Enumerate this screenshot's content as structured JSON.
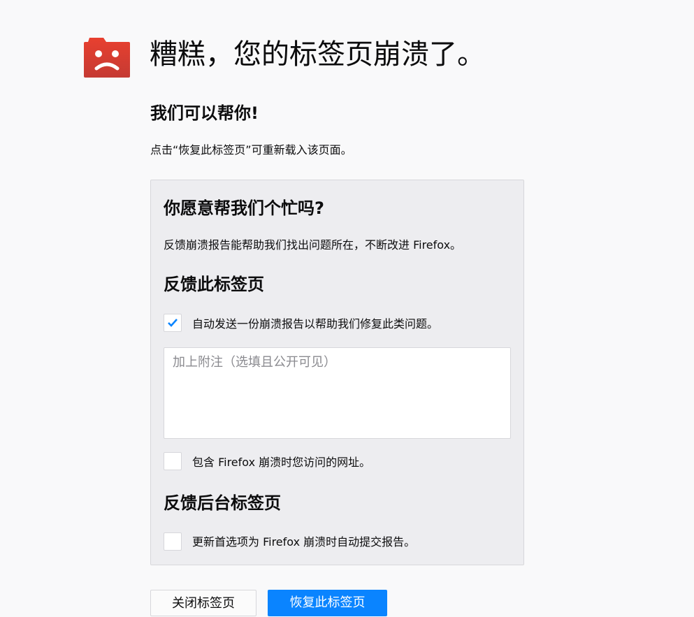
{
  "header": {
    "title": "糟糕，您的标签页崩溃了。",
    "icon": "sad-tab-icon",
    "icon_color": "#e03a2f"
  },
  "help": {
    "heading": "我们可以帮你!",
    "description": "点击“恢复此标签页”可重新载入该页面。"
  },
  "panel": {
    "heading": "你愿意帮我们个忙吗?",
    "description": "反馈崩溃报告能帮助我们找出问题所在，不断改进 Firefox。",
    "report_tab_heading": "反馈此标签页",
    "auto_send_label": "自动发送一份崩溃报告以帮助我们修复此类问题。",
    "auto_send_checked": true,
    "comment_placeholder": "加上附注（选填且公开可见）",
    "include_url_label": "包含 Firefox 崩溃时您访问的网址。",
    "include_url_checked": false,
    "background_heading": "反馈后台标签页",
    "update_pref_label": "更新首选项为 Firefox 崩溃时自动提交报告。",
    "update_pref_checked": false
  },
  "buttons": {
    "close": "关闭标签页",
    "restore": "恢复此标签页"
  },
  "colors": {
    "accent": "#0a84ff",
    "check": "#0a84ff"
  }
}
